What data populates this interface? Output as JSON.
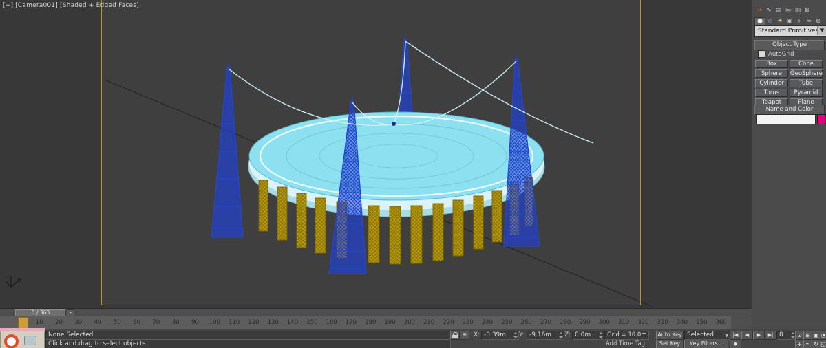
{
  "viewport": {
    "label": "[+] [Camera001] [Shaded + Edged Faces]"
  },
  "colors": {
    "viewport_frame": "#b3942e",
    "dish": "#8ce0ef",
    "towers": "#2746d6",
    "trusses": "#b89a10",
    "name_swatch": "#e6007e"
  },
  "command_panel": {
    "tabs": [
      {
        "name": "create",
        "glyph": "→"
      },
      {
        "name": "modify",
        "glyph": "∿"
      },
      {
        "name": "hierarchy",
        "glyph": "▤"
      },
      {
        "name": "motion",
        "glyph": "◎"
      },
      {
        "name": "display",
        "glyph": "▥"
      },
      {
        "name": "utilities",
        "glyph": "⊠"
      }
    ],
    "categories": [
      {
        "name": "geometry",
        "glyph": "●"
      },
      {
        "name": "shapes",
        "glyph": "◇"
      },
      {
        "name": "lights",
        "glyph": "☀"
      },
      {
        "name": "cameras",
        "glyph": "◉"
      },
      {
        "name": "helpers",
        "glyph": "+"
      },
      {
        "name": "space-warps",
        "glyph": "≈"
      },
      {
        "name": "systems",
        "glyph": "⊛"
      }
    ],
    "primitives_dropdown": "Standard Primitives",
    "dropdown_arrow": "▼",
    "object_type": {
      "title": "Object Type",
      "autogrid_label": "AutoGrid",
      "buttons": [
        "Box",
        "Cone",
        "Sphere",
        "GeoSphere",
        "Cylinder",
        "Tube",
        "Torus",
        "Pyramid",
        "Teapot",
        "Plane"
      ]
    },
    "name_and_color": {
      "title": "Name and Color",
      "object_name": "",
      "swatch_color": "#e6007e"
    }
  },
  "timeline": {
    "slider_label": "0 / 360",
    "slider_arrow": "▸",
    "ticks": [
      "10",
      "20",
      "30",
      "40",
      "50",
      "60",
      "70",
      "80",
      "90",
      "100",
      "110",
      "120",
      "130",
      "140",
      "150",
      "160",
      "170",
      "180",
      "190",
      "200",
      "210",
      "220",
      "230",
      "240",
      "250",
      "260",
      "270",
      "280",
      "290",
      "300",
      "310",
      "320",
      "330",
      "340",
      "350",
      "360"
    ]
  },
  "status_bar": {
    "selection_status": "None Selected",
    "prompt": "Click and drag to select objects",
    "x_label": "X:",
    "x_value": "-0.39m",
    "y_label": "Y:",
    "y_value": "-9.16m",
    "z_label": "Z:",
    "z_value": "0.0m",
    "grid": "Grid = 10.0m",
    "add_time_tag": "Add Time Tag",
    "auto_key": "Auto Key",
    "set_key": "Set Key",
    "key_mode_dropdown": "Selected",
    "key_filters": "Key Filters...",
    "frame_field": "0",
    "playback": {
      "go_start": "|◀",
      "prev": "◀",
      "play": "▶",
      "go_end": "▶|",
      "key_mode": "◆"
    },
    "nav": {
      "zoom": "⊙",
      "zoom_all": "⊞",
      "zoom_extents": "▣",
      "fov": "◔",
      "pan": "+",
      "walk": "≈",
      "orbit": "↻",
      "maximize": "◱"
    }
  }
}
